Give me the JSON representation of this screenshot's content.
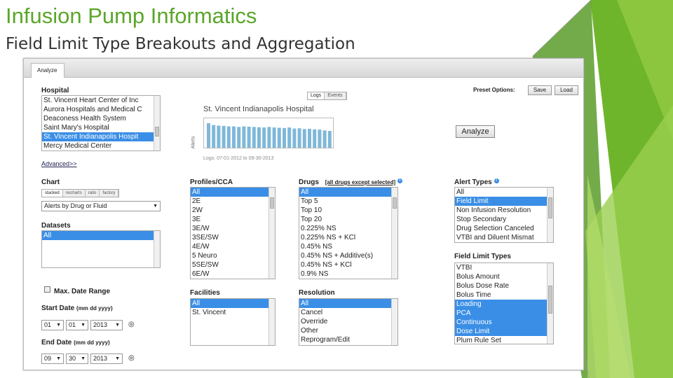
{
  "slide": {
    "title": "Infusion Pump Informatics",
    "subtitle": "Field Limit Type Breakouts and Aggregation"
  },
  "app": {
    "tab": "Analyze",
    "preset": {
      "label": "Preset Options:",
      "save": "Save",
      "load": "Load"
    },
    "analyze_button": "Analyze",
    "hospital": {
      "label": "Hospital",
      "items": [
        "St. Vincent Heart Center of Inc",
        "Aurora Hospitals and Medical C",
        "Deaconess Health System",
        "Saint Mary's Hospital",
        "St. Vincent Indianapolis Hospit",
        "Mercy Medical Center"
      ],
      "selected_index": 4
    },
    "preview": {
      "toggle": [
        "Logs",
        "Events"
      ],
      "title": "St. Vincent Indianapolis Hospital",
      "ylabel": "Alerts",
      "caption": "Logs: 07-01-2012 to 09-30-2013",
      "bars": [
        0.92,
        0.85,
        0.83,
        0.82,
        0.8,
        0.8,
        0.78,
        0.8,
        0.79,
        0.78,
        0.77,
        0.76,
        0.78,
        0.76,
        0.75,
        0.74,
        0.76,
        0.72,
        0.73,
        0.7,
        0.71,
        0.69,
        0.68,
        0.65,
        0.63
      ]
    },
    "advanced_link": "Advanced>>",
    "chart": {
      "label": "Chart",
      "segments": [
        "stacked",
        "nocharts",
        "ratio",
        "factory"
      ],
      "dropdown": "Alerts by Drug or Fluid"
    },
    "datasets": {
      "label": "Datasets",
      "items": [
        "All"
      ],
      "selected_index": 0
    },
    "profiles": {
      "label": "Profiles/CCA",
      "items": [
        "All",
        "2E",
        "2W",
        "3E",
        "3E/W",
        "3SE/SW",
        "4E/W",
        "5 Neuro",
        "5SE/SW",
        "6E/W"
      ],
      "selected_index": 0
    },
    "drugs": {
      "label": "Drugs",
      "note": "[all drugs except selected]",
      "items": [
        "All",
        "Top 5",
        "Top 10",
        "Top 20",
        "0.225% NS",
        "0.225% NS + KCl",
        "0.45% NS",
        "0.45% NS + Additive(s)",
        "0.45% NS + KCl",
        "0.9% NS"
      ],
      "selected_index": 0
    },
    "alert_types": {
      "label": "Alert Types",
      "items": [
        "All",
        "Field Limit",
        "Non Infusion Resolution",
        "Stop Secondary",
        "Drug Selection Canceled",
        "VTBI and Diluent Mismat"
      ],
      "selected_index": 1
    },
    "field_limit_types": {
      "label": "Field Limit Types",
      "items": [
        "VTBI",
        "Bolus Amount",
        "Bolus Dose Rate",
        "Bolus Time",
        "Loading",
        "PCA",
        "Continuous",
        "Dose Limit",
        "Plum Rule Set"
      ],
      "selected_indexes": [
        4,
        5,
        6,
        7
      ]
    },
    "facilities": {
      "label": "Facilities",
      "items": [
        "All",
        "St. Vincent"
      ],
      "selected_index": 0
    },
    "resolution": {
      "label": "Resolution",
      "items": [
        "All",
        "Cancel",
        "Override",
        "Other",
        "Reprogram/Edit"
      ],
      "selected_index": 0
    },
    "max_date_range": "Max. Date Range",
    "start_date": {
      "label": "Start Date",
      "format": "(mm dd yyyy)",
      "month": "01",
      "day": "01",
      "year": "2013"
    },
    "end_date": {
      "label": "End Date",
      "format": "(mm dd yyyy)",
      "month": "09",
      "day": "30",
      "year": "2013"
    },
    "colors": {
      "selection": "#3a8ee6",
      "title_green": "#5aa62a",
      "bar": "#7fb8d8"
    }
  }
}
